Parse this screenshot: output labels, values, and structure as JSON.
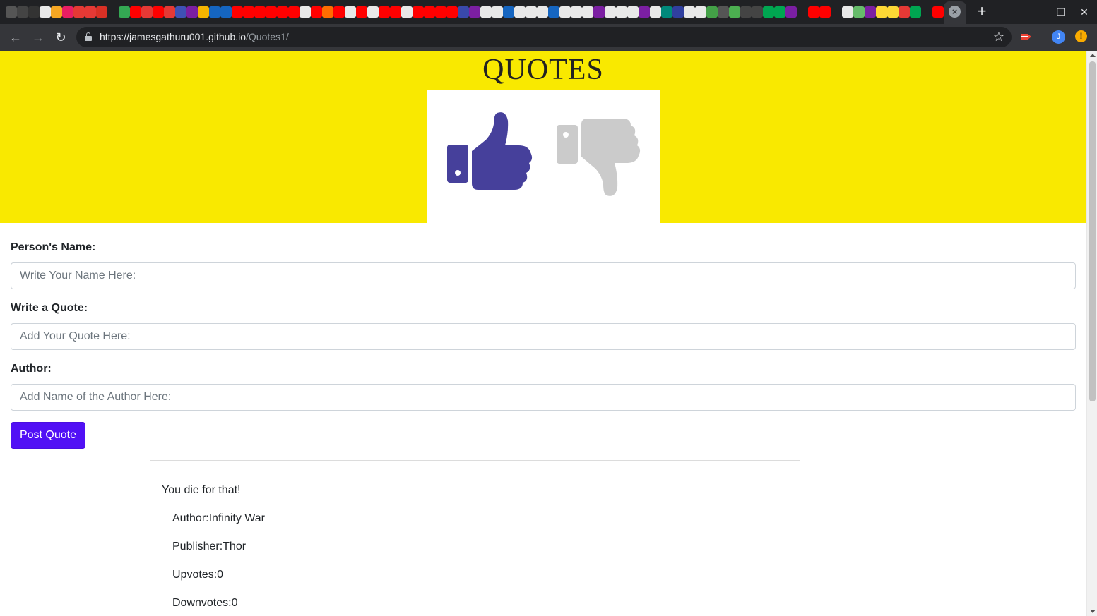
{
  "browser": {
    "url_host": "https://jamesgathuru001.github.io",
    "url_path": "/Quotes1/",
    "profile_initial": "J",
    "alert_glyph": "!",
    "pinned_tab_colors": [
      "#555",
      "#444",
      "#333",
      "#e8e8e8",
      "#f5a623",
      "#e91e63",
      "#e53935",
      "#e53935",
      "#d93025",
      "#202124",
      "#34a853",
      "#ff0000",
      "#e53935",
      "#ff0000",
      "#e53935",
      "#3f51b5",
      "#7b1fa2",
      "#f4b400",
      "#1565c0",
      "#1565c0",
      "#ff0000",
      "#ff0000",
      "#ff0000",
      "#ff0000",
      "#ff0000",
      "#ff0000",
      "#e8e8e8",
      "#ff0000",
      "#ff6d00",
      "#ff0000",
      "#e8e8e8",
      "#ff0000",
      "#e8e8e8",
      "#ff0000",
      "#ff0000",
      "#e8e8e8",
      "#ff0000",
      "#ff0000",
      "#ff0000",
      "#ff0000",
      "#3949ab",
      "#7b1fa2",
      "#e8e8e8",
      "#e8e8e8",
      "#1565c0",
      "#e8e8e8",
      "#e8e8e8",
      "#e8e8e8",
      "#1565c0",
      "#e8e8e8",
      "#e8e8e8",
      "#e8e8e8",
      "#7b1fa2",
      "#e8e8e8",
      "#e8e8e8",
      "#e8e8e8",
      "#7b1fa2",
      "#e8e8e8",
      "#00897b",
      "#303f9f",
      "#e8e8e8",
      "#e8e8e8",
      "#43a047",
      "#555",
      "#4caf50",
      "#444",
      "#444",
      "#00a651",
      "#00a651",
      "#7b1fa2",
      "#202124",
      "#ff0000",
      "#ff0000",
      "#202124",
      "#e8e8e8",
      "#66bb6a",
      "#7b1fa2",
      "#fdd835",
      "#fdd835",
      "#e53935",
      "#00a651",
      "#202124",
      "#ff0000",
      "#ff0000",
      "#e8e8e8"
    ]
  },
  "page": {
    "title": "QUOTES"
  },
  "form": {
    "name_label": "Person's Name:",
    "name_placeholder": "Write Your Name Here:",
    "quote_label": "Write a Quote:",
    "quote_placeholder": "Add Your Quote Here:",
    "author_label": "Author:",
    "author_placeholder": "Add Name of the Author Here:",
    "submit_label": "Post Quote"
  },
  "colors": {
    "header_bg": "#f9e900",
    "thumbs_up": "#46409b",
    "thumbs_down": "#cbcbcb",
    "button": "#5110f5"
  },
  "quotes": [
    {
      "text": "You die for that!",
      "author_line": "Author:Infinity War",
      "publisher_line": "Publisher:Thor",
      "upvotes_line": "Upvotes:0",
      "downvotes_line": "Downvotes:0"
    }
  ]
}
